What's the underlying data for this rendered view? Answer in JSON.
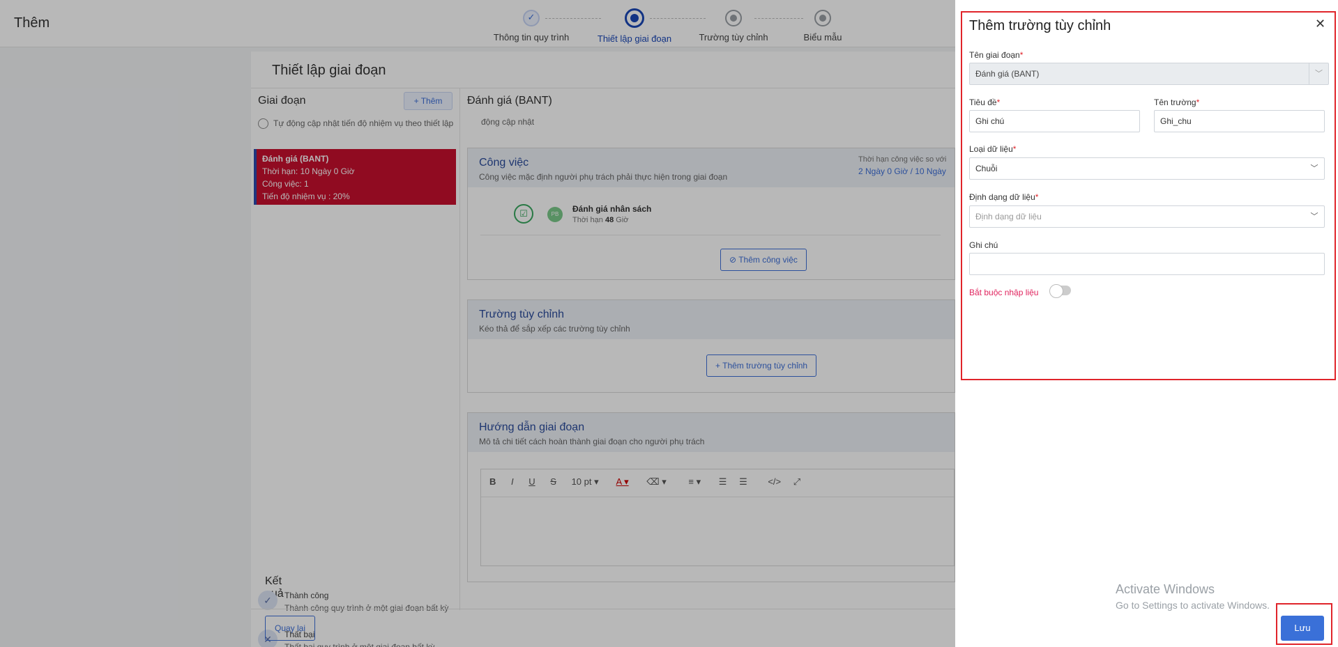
{
  "header": {
    "title": "Thêm"
  },
  "stepper": {
    "steps": [
      {
        "label": "Thông tin quy trình",
        "state": "done"
      },
      {
        "label": "Thiết lập giai đoạn",
        "state": "active"
      },
      {
        "label": "Trường tùy chỉnh",
        "state": "pending"
      },
      {
        "label": "Biểu mẫu",
        "state": "pending"
      }
    ],
    "done_mark": "✓"
  },
  "card": {
    "title": "Thiết lập giai đoạn"
  },
  "phases": {
    "heading": "Giai đoạn",
    "add_label": "+ Thêm",
    "auto_update_text": "Tự động cập nhật tiến độ nhiệm vụ theo thiết lập",
    "item": {
      "name": "Đánh giá (BANT)",
      "deadline": "Thời hạn: 10 Ngày 0 Giờ",
      "tasks": "Công việc: 1",
      "progress": "Tiến độ nhiệm vụ :  20%"
    }
  },
  "results": {
    "heading": "Kết quả",
    "success_title": "Thành công",
    "success_desc": "Thành công quy trình ở một giai đoạn bất kỳ",
    "fail_title": "Thất bại",
    "fail_desc": "Thất bại quy trình ở một giai đoạn bất kỳ"
  },
  "detail": {
    "phase_name": "Đánh giá (BANT)",
    "partial_text": "động cập nhật",
    "tasks_box": {
      "title": "Công việc",
      "subtitle": "Công việc mặc định người phụ trách phải thực hiện trong giai đoạn",
      "deadline_label": "Thời hạn công việc so với",
      "deadline_value": "2 Ngày 0 Giờ / 10 Ngày",
      "task_name": "Đánh giá nhân sách",
      "task_deadline_prefix": "Thời hạn",
      "task_deadline_value": "48",
      "task_deadline_unit": "Giờ",
      "avatar_initials": "PB",
      "add_task_label": "Thêm công việc"
    },
    "custom_fields_box": {
      "title": "Trường tùy chỉnh",
      "subtitle": "Kéo thả để sắp xếp các trường tùy chỉnh",
      "add_label": "+ Thêm trường tùy chỉnh"
    },
    "guide_box": {
      "title": "Hướng dẫn giai đoạn",
      "subtitle": "Mô tả chi tiết cách hoàn thành giai đoạn cho người phụ trách",
      "font_size": "10 pt"
    }
  },
  "back_label": "Quay lại",
  "drawer": {
    "title": "Thêm trường tùy chỉnh",
    "close_glyph": "✕",
    "phase_label": "Tên giai đoạn",
    "phase_value": "Đánh giá (BANT)",
    "title_label": "Tiêu đề",
    "title_value": "Ghi chú",
    "field_name_label": "Tên trường",
    "field_name_value": "Ghi_chu",
    "data_type_label": "Loại dữ liệu",
    "data_type_value": "Chuỗi",
    "data_format_label": "Định dạng dữ liệu",
    "data_format_placeholder": "Định dạng dữ liệu",
    "note_label": "Ghi chú",
    "note_value": "",
    "required_label": "Bắt buộc nhập liệu",
    "required_on": false,
    "required_mark": "*"
  },
  "watermark": {
    "line1": "Activate Windows",
    "line2": "Go to Settings to activate Windows."
  },
  "save_label": "Lưu",
  "colors": {
    "accent": "#3a70d8",
    "danger": "#e0242a",
    "phase_bg": "#c8102e"
  }
}
